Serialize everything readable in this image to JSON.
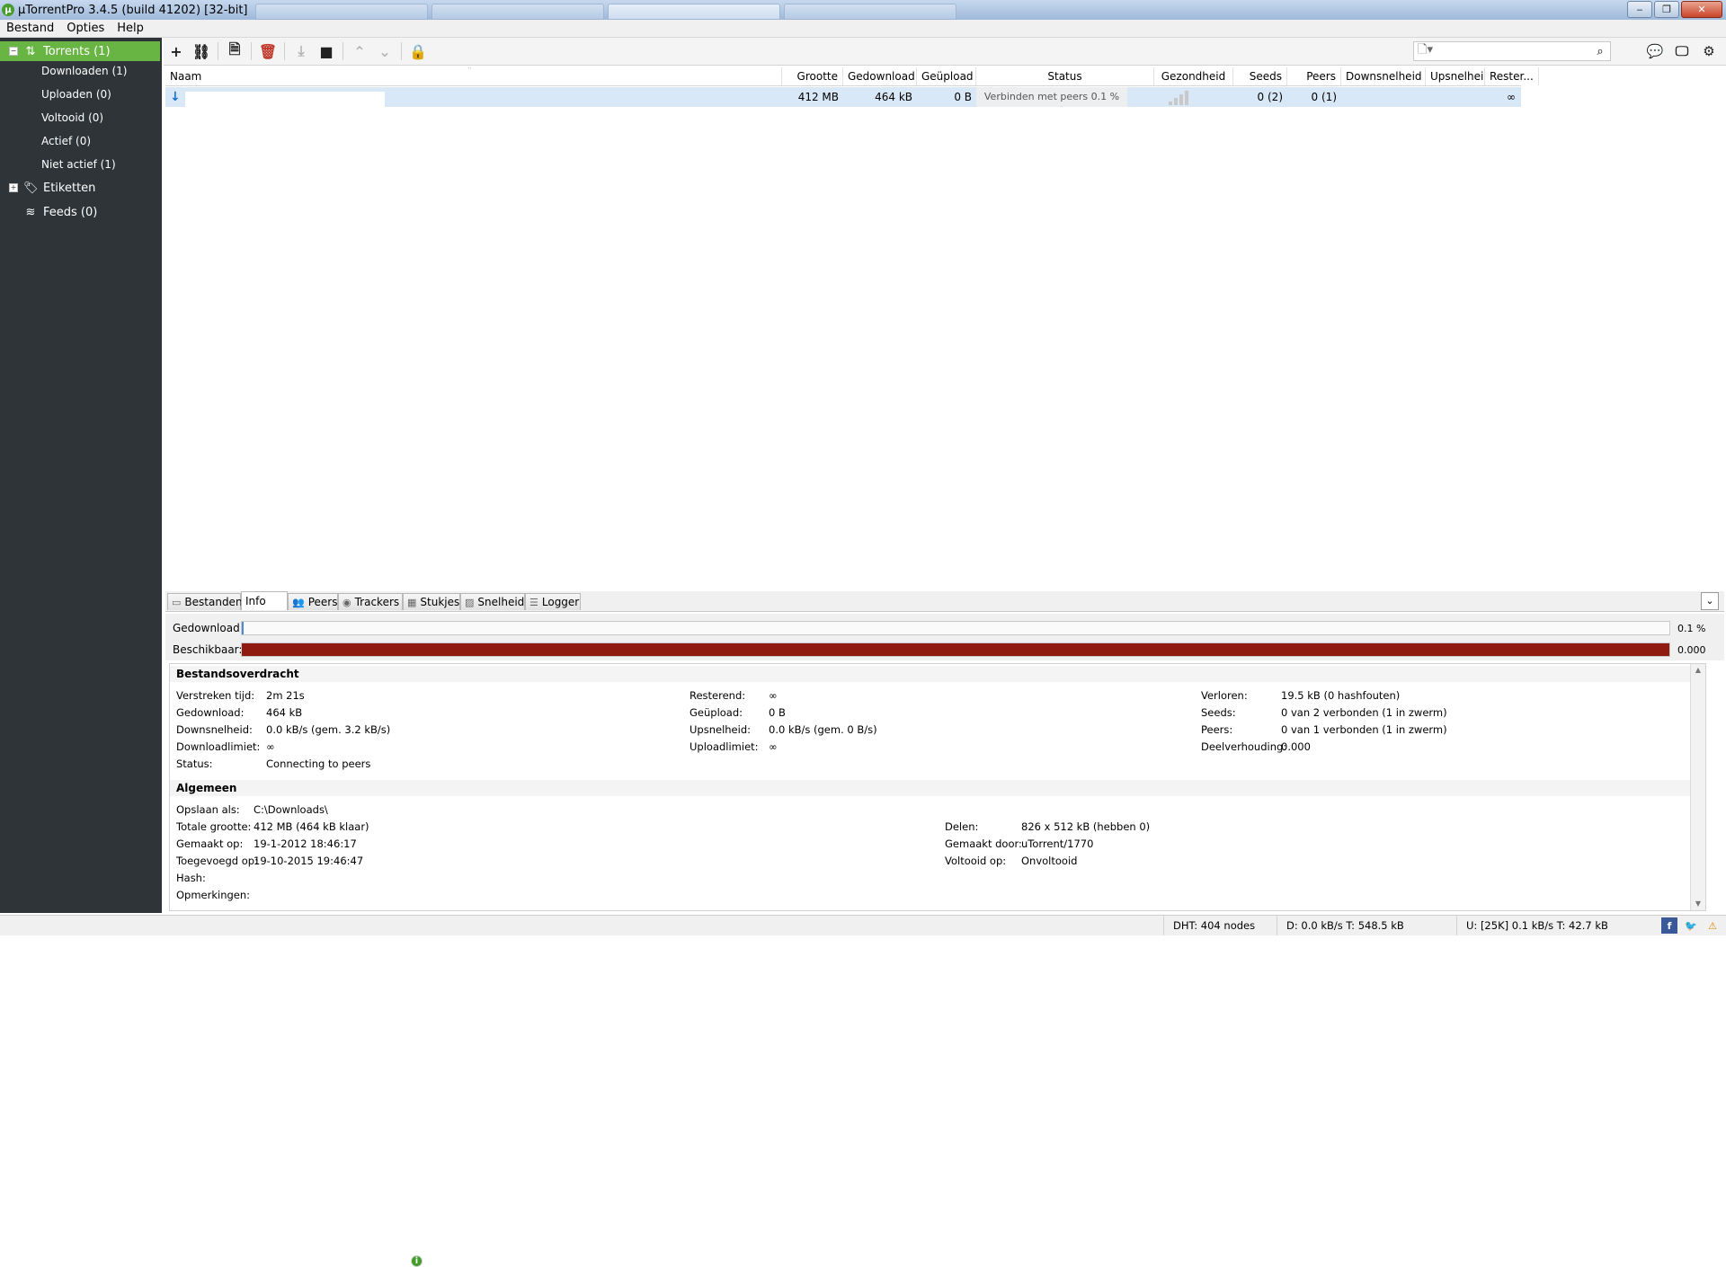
{
  "window": {
    "title": "µTorrentPro 3.4.5  (build 41202) [32-bit]",
    "logo_letter": "µ",
    "controls": {
      "minimize": "‒",
      "maximize": "❐",
      "close": "✕"
    }
  },
  "menu": [
    "Bestand",
    "Opties",
    "Help"
  ],
  "sidebar": {
    "torrents": {
      "label": "Torrents (1)",
      "expander": "−",
      "icon": "torrents-arrows-icon"
    },
    "items": [
      {
        "label": "Downloaden (1)"
      },
      {
        "label": "Uploaden (0)"
      },
      {
        "label": "Voltooid (0)"
      },
      {
        "label": "Actief (0)"
      },
      {
        "label": "Niet actief (1)"
      }
    ],
    "labels": {
      "label": "Etiketten",
      "expander": "+",
      "icon": "tag-icon"
    },
    "feeds": {
      "label": "Feeds (0)",
      "icon": "rss-icon"
    }
  },
  "toolbar": {
    "add": "+",
    "add_link": "⛓",
    "create": "🗎",
    "remove": "🗑",
    "download": "⤓",
    "stop": "■",
    "up": "⌃",
    "down": "⌄",
    "lock": "🔒",
    "search_placeholder": "",
    "search_doc": "🗋▾",
    "search_btn": "⌕",
    "chat": "💬",
    "remote": "🖵",
    "settings": "⚙"
  },
  "table": {
    "columns": [
      "Naam",
      "Grootte",
      "Gedownload",
      "Geüpload",
      "Status",
      "Gezondheid",
      "Seeds",
      "Peers",
      "Downsnelheid",
      "Upsnelheid",
      "Rester..."
    ],
    "sort_indicator": "˄",
    "rows": [
      {
        "icon": "↓",
        "name": "",
        "size": "412 MB",
        "downloaded": "464 kB",
        "uploaded": "0 B",
        "status": "Verbinden met peers 0.1 %",
        "seeds": "0 (2)",
        "peers": "0 (1)",
        "down_speed": "",
        "up_speed": "",
        "remaining": "∞"
      }
    ]
  },
  "tabs": [
    {
      "label": "Bestanden",
      "icon": "▭"
    },
    {
      "label": "Info",
      "icon": "i"
    },
    {
      "label": "Peers",
      "icon": "👥"
    },
    {
      "label": "Trackers",
      "icon": "◉"
    },
    {
      "label": "Stukjes",
      "icon": "▦"
    },
    {
      "label": "Snelheid",
      "icon": "▨"
    },
    {
      "label": "Logger",
      "icon": "☰"
    }
  ],
  "collapse_btn": "⌄",
  "progress": {
    "downloaded_label": "Gedownload:",
    "downloaded_value": "0.1 %",
    "downloaded_fraction": 0.001,
    "available_label": "Beschikbaar:",
    "available_value": "0.000",
    "available_fraction": 1.0
  },
  "transfer": {
    "heading": "Bestandsoverdracht",
    "col1": [
      {
        "k": "Verstreken tijd:",
        "v": "2m 21s"
      },
      {
        "k": "Gedownload:",
        "v": "464 kB"
      },
      {
        "k": "Downsnelheid:",
        "v": "0.0 kB/s (gem. 3.2 kB/s)"
      },
      {
        "k": "Downloadlimiet:",
        "v": "∞"
      },
      {
        "k": "Status:",
        "v": "Connecting to peers"
      }
    ],
    "col2": [
      {
        "k": "Resterend:",
        "v": "∞"
      },
      {
        "k": "Geüpload:",
        "v": "0 B"
      },
      {
        "k": "Upsnelheid:",
        "v": "0.0 kB/s (gem. 0 B/s)"
      },
      {
        "k": "Uploadlimiet:",
        "v": "∞"
      }
    ],
    "col3": [
      {
        "k": "Verloren:",
        "v": "19.5 kB (0 hashfouten)"
      },
      {
        "k": "Seeds:",
        "v": "0 van 2 verbonden (1 in zwerm)"
      },
      {
        "k": "Peers:",
        "v": "0 van 1 verbonden (1 in zwerm)"
      },
      {
        "k": "Deelverhouding:",
        "v": "0.000"
      }
    ]
  },
  "general": {
    "heading": "Algemeen",
    "col1": [
      {
        "k": "Opslaan als:",
        "v": "C:\\Downloads\\"
      },
      {
        "k": "Totale grootte:",
        "v": "412 MB (464 kB klaar)"
      },
      {
        "k": "Gemaakt op:",
        "v": "19-1-2012 18:46:17"
      },
      {
        "k": "Toegevoegd op:",
        "v": "19-10-2015 19:46:47"
      },
      {
        "k": "Hash:",
        "v": ""
      },
      {
        "k": "Opmerkingen:",
        "v": ""
      }
    ],
    "col2": [
      {
        "k": "Delen:",
        "v": "826 x 512 kB (hebben 0)"
      },
      {
        "k": "Gemaakt door:",
        "v": "uTorrent/1770"
      },
      {
        "k": "Voltooid op:",
        "v": "Onvoltooid"
      }
    ]
  },
  "statusbar": {
    "dht": "DHT: 404 nodes",
    "down": "D: 0.0 kB/s T: 548.5 kB",
    "up": "U: [25K] 0.1 kB/s T: 42.7 kB",
    "icons": [
      "facebook-icon",
      "twitter-icon",
      "warning-icon"
    ],
    "facebook": "f",
    "twitter": "🐦",
    "warning": "⚠"
  },
  "colors": {
    "accent": "#69b544",
    "sidebar_bg": "#2e3438",
    "available_bar": "#8e1a10",
    "row_selected": "#d9e8f7"
  }
}
